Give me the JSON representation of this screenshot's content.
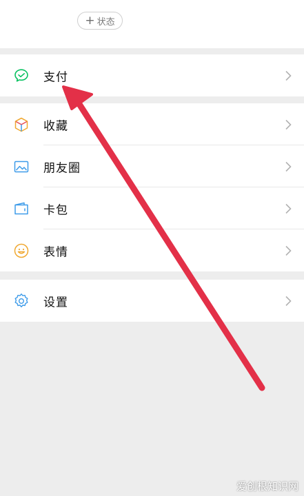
{
  "status": {
    "label": "状态",
    "plus": "+"
  },
  "menu": {
    "pay": {
      "label": "支付",
      "icon": "wechat-pay-icon"
    },
    "favorites": {
      "label": "收藏",
      "icon": "cube-icon"
    },
    "moments": {
      "label": "朋友圈",
      "icon": "image-icon"
    },
    "cards": {
      "label": "卡包",
      "icon": "wallet-card-icon"
    },
    "stickers": {
      "label": "表情",
      "icon": "smiley-icon"
    },
    "settings": {
      "label": "设置",
      "icon": "gear-icon"
    }
  },
  "watermark": "爱创根知识网",
  "colors": {
    "pay_green": "#07c160",
    "arrow_red": "#e33048",
    "background": "#ededed"
  }
}
